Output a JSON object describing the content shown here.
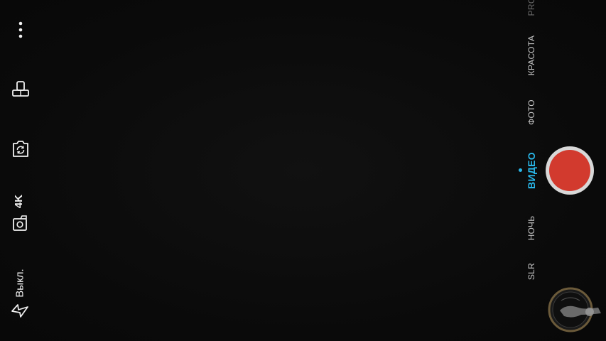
{
  "left_controls": {
    "menu_icon": "more-vert-icon",
    "timer_icon": "hand-timer-icon",
    "switch_camera_icon": "switch-camera-icon",
    "resolution_label": "4K",
    "flash_label": "Выкл."
  },
  "modes": [
    {
      "label": "PRO",
      "state": "dim"
    },
    {
      "label": "КРАСОТА",
      "state": "normal"
    },
    {
      "label": "ФОТО",
      "state": "normal"
    },
    {
      "label": "ВИДЕО",
      "state": "active"
    },
    {
      "label": "НОЧЬ",
      "state": "normal"
    },
    {
      "label": "SLR",
      "state": "normal"
    }
  ],
  "colors": {
    "accent": "#29b6e8",
    "record": "#d23a2e",
    "background": "#0a0a0a"
  }
}
